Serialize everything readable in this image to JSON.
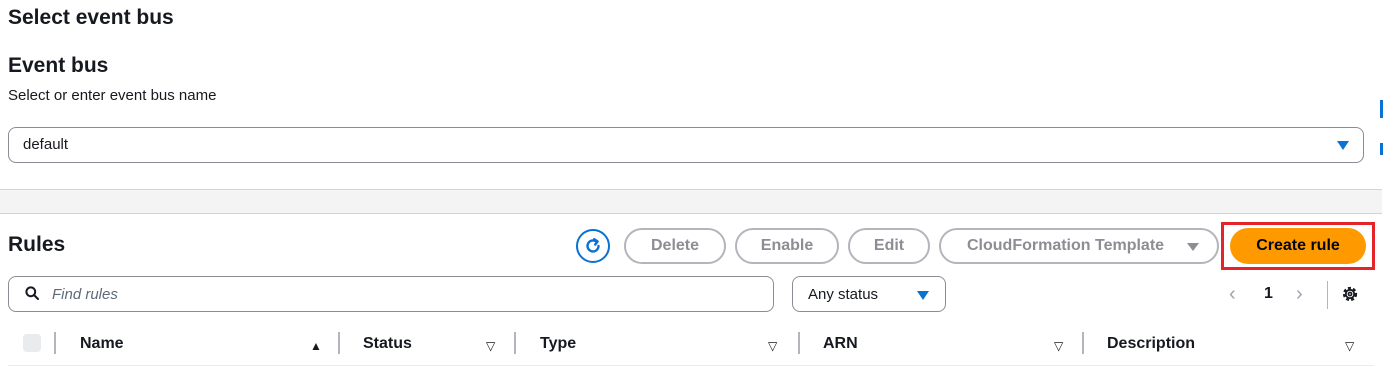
{
  "event_bus_section": {
    "title": "Select event bus",
    "label": "Event bus",
    "description": "Select or enter event bus name",
    "selected": "default"
  },
  "rules": {
    "title": "Rules",
    "buttons": {
      "delete": "Delete",
      "enable": "Enable",
      "edit": "Edit",
      "cloudformation": "CloudFormation Template",
      "create": "Create rule"
    },
    "search_placeholder": "Find rules",
    "status_filter": "Any status",
    "pagination": {
      "prev": "‹",
      "page": "1",
      "next": "›"
    },
    "columns": [
      "Name",
      "Status",
      "Type",
      "ARN",
      "Description"
    ]
  },
  "colors": {
    "accent": "#0972d3",
    "primary_button": "#ff9900",
    "highlight": "#e5232a"
  },
  "icons": {
    "refresh": "refresh-icon",
    "search": "search-icon",
    "settings": "gear-icon",
    "dropdown": "caret-down-icon"
  }
}
